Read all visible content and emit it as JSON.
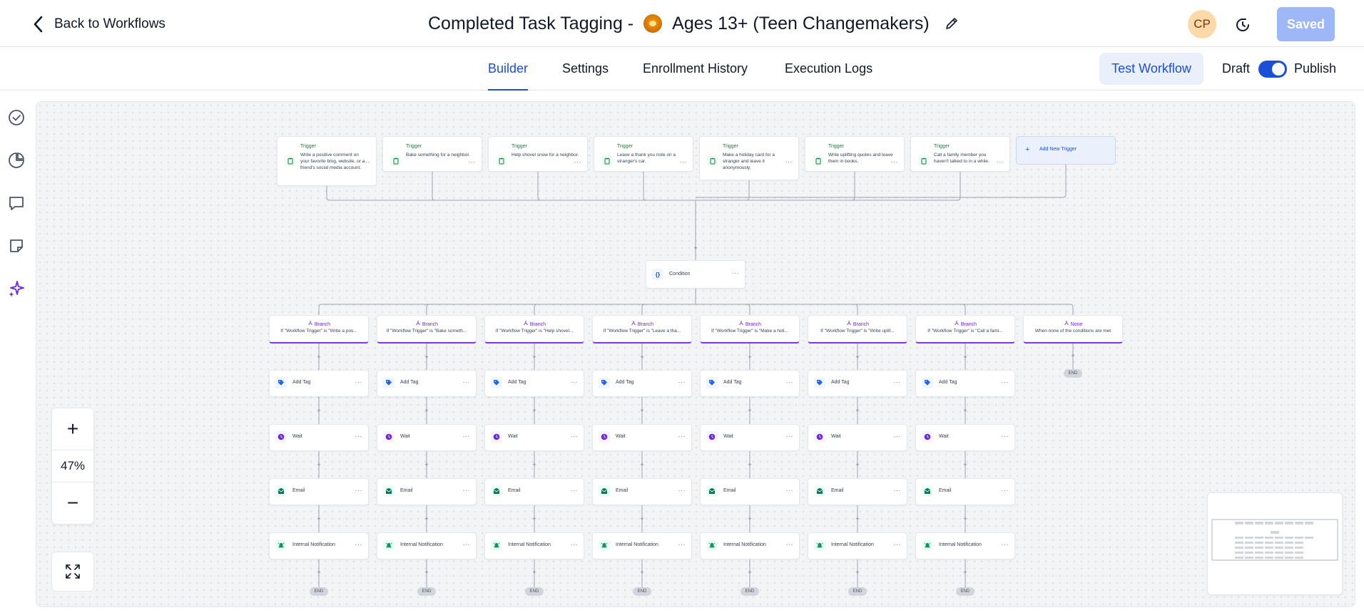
{
  "header": {
    "back_label": "Back to Workflows",
    "title_prefix": "Completed Task Tagging -",
    "title_suffix": "Ages 13+ (Teen Changemakers)",
    "avatar_initials": "CP",
    "saved_label": "Saved"
  },
  "tabs": [
    {
      "label": "Builder",
      "active": true
    },
    {
      "label": "Settings",
      "active": false
    },
    {
      "label": "Enrollment History",
      "active": false
    },
    {
      "label": "Execution Logs",
      "active": false
    }
  ],
  "actions": {
    "test_workflow": "Test Workflow",
    "draft": "Draft",
    "publish": "Publish",
    "published": true
  },
  "sidebar": {
    "icons": [
      "check-circle-icon",
      "pie-chart-icon",
      "comment-icon",
      "note-icon",
      "sparkles-icon"
    ]
  },
  "canvas": {
    "trigger_label": "Trigger",
    "triggers": [
      "Write a positive comment on your favorite blog, website, or a friend's social media account.",
      "Bake something for a neighbor.",
      "Help shovel snow for a neighbor.",
      "Leave a thank you note on a stranger's car.",
      "Make a holiday card for a stranger and leave it anonymously.",
      "Write uplifting quotes and leave them in books.",
      "Call a family member you haven't talked to in a while."
    ],
    "add_trigger_label": "Add New Trigger",
    "condition_label": "Condition",
    "branch_label": "Branch",
    "branches": [
      "If \"Workflow Trigger\" is \"Write a pos...",
      "If \"Workflow Trigger\" is \"Bake someth...",
      "If \"Workflow Trigger\" is \"Help shovel...",
      "If \"Workflow Trigger\" is \"Leave a tha...",
      "If \"Workflow Trigger\" is \"Make a holi...",
      "If \"Workflow Trigger\" is \"Write uplif...",
      "If \"Workflow Trigger\" is \"Call a fami..."
    ],
    "none_label": "None",
    "none_desc": "When none of the conditions are met",
    "steps": [
      "Add Tag",
      "Wait",
      "Email",
      "Internal Notification"
    ],
    "end_label": "END",
    "plus": "+",
    "more": "···"
  },
  "colors": {
    "accent": "#1d4ed8",
    "branch": "#7c3aed",
    "trigger": "#15803d",
    "tag": "#2563eb",
    "wait": "#6d28d9",
    "email": "#047857",
    "notification": "#059669"
  },
  "zoom": {
    "in": "+",
    "level": "47%",
    "out": "−"
  }
}
